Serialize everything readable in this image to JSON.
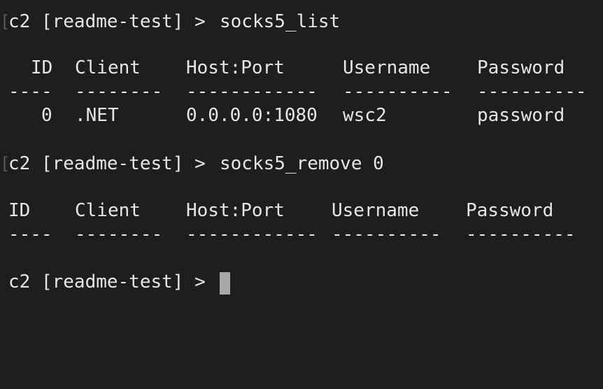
{
  "session1": {
    "prompt": "c2 [readme-test] > ",
    "command": "socks5_list",
    "headers": [
      "ID",
      "Client",
      "Host:Port",
      "Username",
      "Password"
    ],
    "separators": [
      "----",
      "--------",
      "------------",
      "----------",
      "----------"
    ],
    "row": [
      "0",
      ".NET",
      "0.0.0.0:1080",
      "wsc2",
      "password"
    ]
  },
  "session2": {
    "prompt": "c2 [readme-test] > ",
    "command": "socks5_remove 0",
    "headers": [
      "ID",
      "Client",
      "Host:Port",
      "Username",
      "Password"
    ],
    "separators": [
      "----",
      "--------",
      "------------",
      "----------",
      "----------"
    ]
  },
  "current_prompt": "c2 [readme-test] > ",
  "scroll_mark": "["
}
